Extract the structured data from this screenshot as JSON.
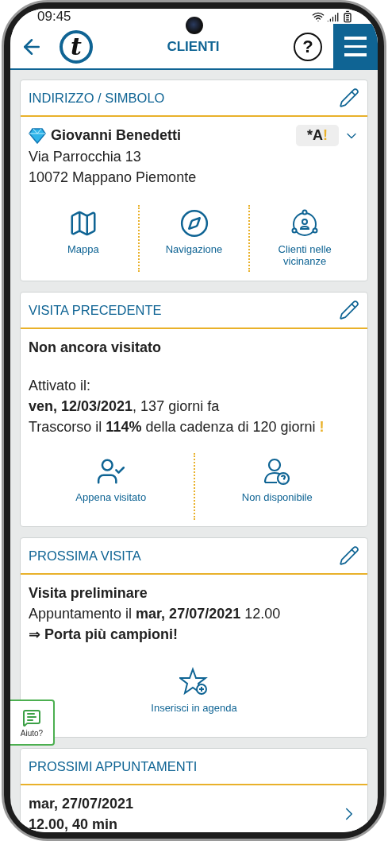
{
  "status_bar": {
    "time": "09:45"
  },
  "header": {
    "logo_letter": "t",
    "title": "CLIENTI",
    "help_symbol": "?"
  },
  "address_card": {
    "title": "INDIRIZZO / SIMBOLO",
    "editable": true,
    "name": "Giovanni Benedetti",
    "badge": {
      "text": "*A",
      "alert": "!"
    },
    "address_lines": [
      "Via Parrocchia 13",
      "10072 Mappano Piemonte"
    ],
    "actions": [
      {
        "kind": "map",
        "label": "Mappa"
      },
      {
        "kind": "navigation",
        "label": "Navigazione"
      },
      {
        "kind": "nearby",
        "label": "Clienti nelle vicinanze"
      }
    ]
  },
  "previous_visit_card": {
    "title": "VISITA PRECEDENTE",
    "editable": true,
    "status": "Non ancora visitato",
    "lines": [
      "Attivato il:",
      "**ven, 12/03/2021**, 137 giorni fa",
      "Trascorso il **114%** della cadenza di 120 giorni"
    ],
    "warning": "!",
    "actions": [
      {
        "kind": "visited",
        "label": "Appena visitato"
      },
      {
        "kind": "unavailable",
        "label": "Non disponibile"
      }
    ]
  },
  "next_visit_card": {
    "title": "PROSSIMA VISITA",
    "editable": true,
    "visit_type": "Visita preliminare",
    "appointment": "Appuntamento il **mar, 27/07/2021** 12.00",
    "note": "⇒ Porta più campioni!",
    "actions": [
      {
        "kind": "agenda",
        "label": "Inserisci in agenda"
      }
    ]
  },
  "appointments_card": {
    "title": "PROSSIMI APPUNTAMENTI",
    "editable": false,
    "items": [
      {
        "date": "mar, 27/07/2021",
        "time": "12.00, 40 min"
      }
    ]
  },
  "help_button": {
    "label": "Aiuto?"
  }
}
